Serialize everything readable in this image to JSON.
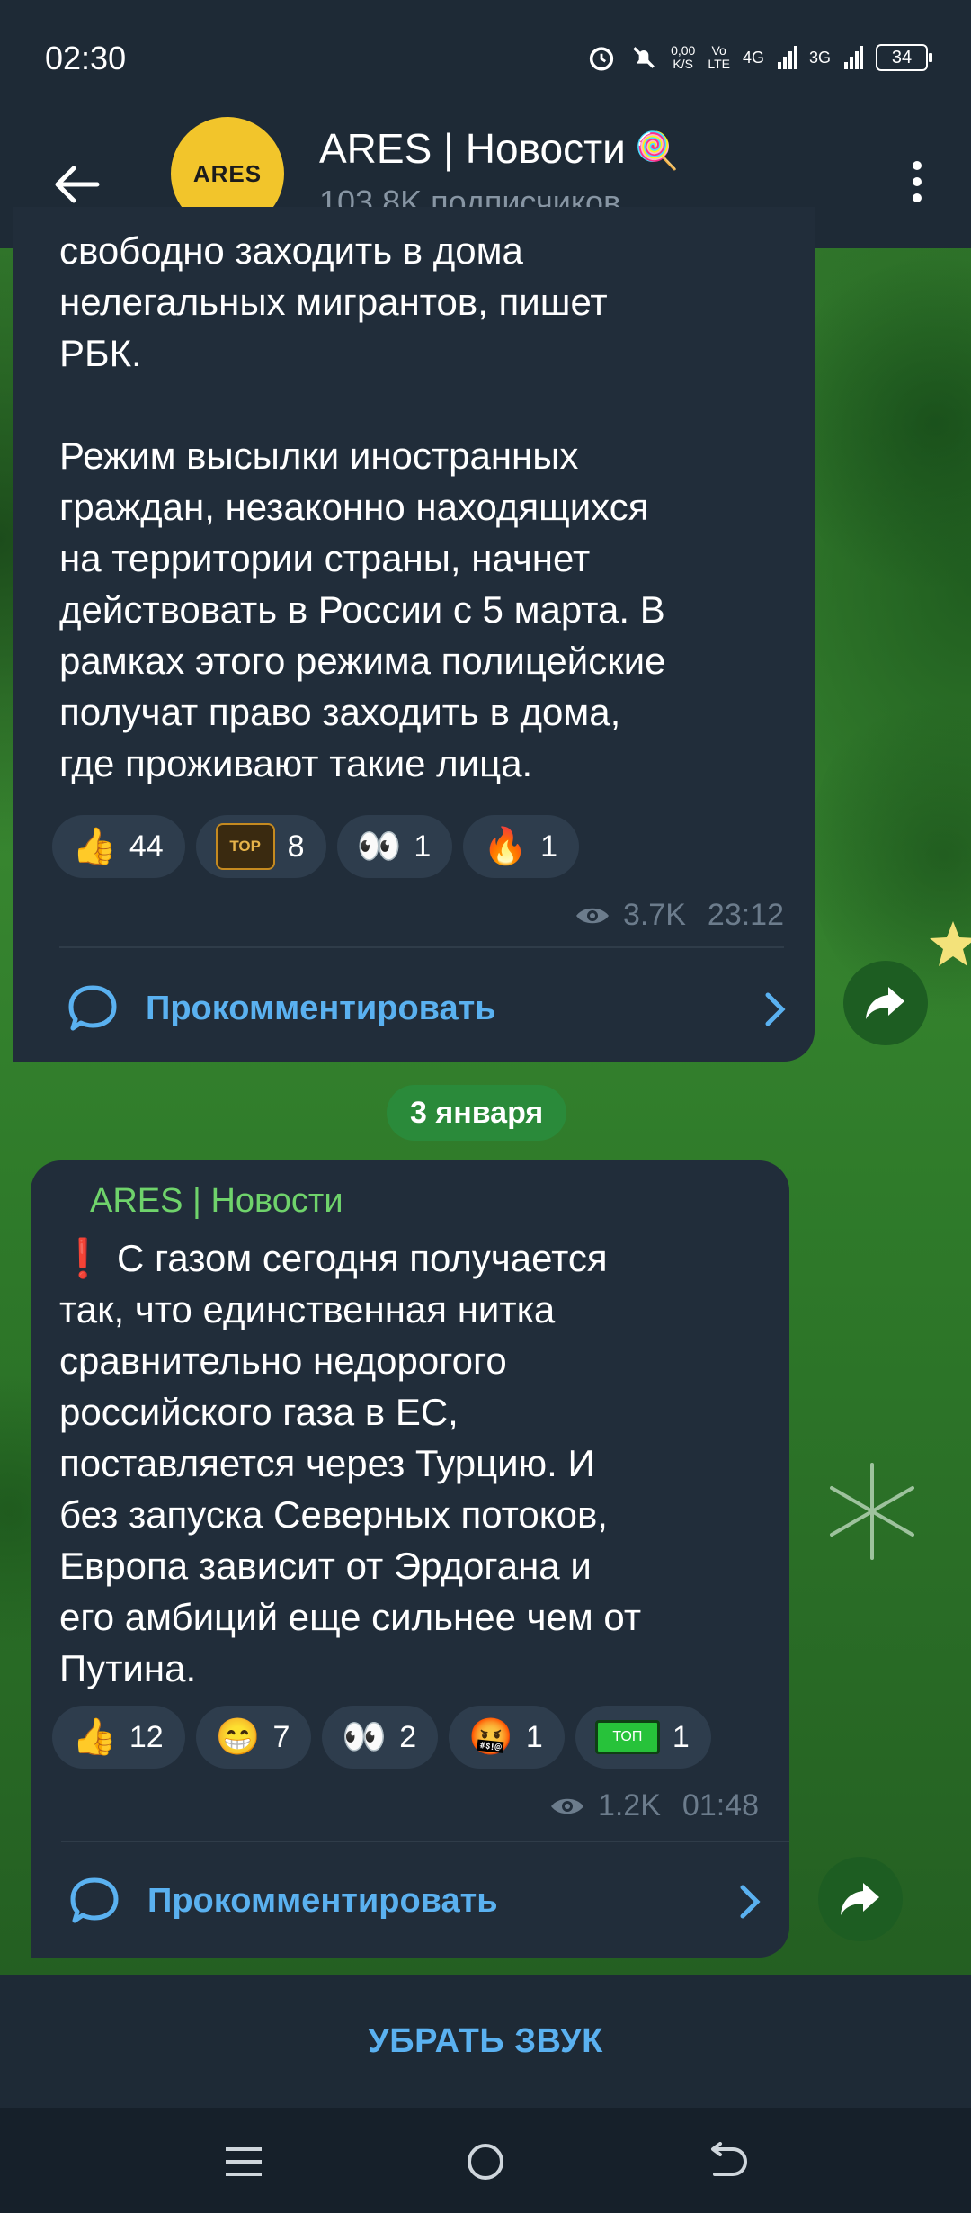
{
  "status_bar": {
    "time": "02:30",
    "net_speed_top": "0,00",
    "net_speed_bottom": "K/S",
    "volte_top": "Vo",
    "volte_bottom": "LTE",
    "network_1": "4G",
    "network_2": "3G",
    "battery": "34",
    "icons": [
      "alarm-icon",
      "mute-bell-icon",
      "signal-icon"
    ]
  },
  "header": {
    "avatar_text": "ARES",
    "channel_title": "ARES | Новости",
    "title_emoji": "🍭",
    "subscribers": "103.8K подписчиков",
    "back_icon": "back-arrow-icon",
    "menu_icon": "more-vert-icon"
  },
  "messages": [
    {
      "text": "свободно заходить в дома\nнелегальных мигрантов, пишет\nРБК.\n\nРежим высылки иностранных\nграждан, незаконно находящихся\nна территории страны, начнет\nдействовать в России с 5 марта. В\nрамках этого режима полицейские\nполучат право заходить в дома,\nгде проживают такие лица.",
      "reactions": [
        {
          "emoji": "👍",
          "count": "44"
        },
        {
          "emoji": "TOP",
          "count": "8"
        },
        {
          "emoji": "👀",
          "count": "1"
        },
        {
          "emoji": "🔥",
          "count": "1"
        }
      ],
      "views": "3.7K",
      "time": "23:12",
      "comment_label": "Прокомментировать"
    },
    {
      "sender": "ARES | Новости",
      "text": "❗ С газом сегодня получается\nтак, что единственная нитка\nсравнительно недорогого\nроссийского газа в ЕС,\nпоставляется через Турцию. И\nбез запуска Северных потоков,\nЕвропа зависит от Эрдогана и\nего амбиций еще сильнее чем от\nПутина.",
      "reactions": [
        {
          "emoji": "👍",
          "count": "12"
        },
        {
          "emoji": "😁",
          "count": "7"
        },
        {
          "emoji": "👀",
          "count": "2"
        },
        {
          "emoji": "🤬",
          "count": "1"
        },
        {
          "emoji": "ТОП",
          "count": "1"
        }
      ],
      "views": "1.2K",
      "time": "01:48",
      "comment_label": "Прокомментировать"
    }
  ],
  "date_separator": "3 января",
  "bottom": {
    "unmute_label": "УБРАТЬ ЗВУК"
  },
  "nav": {
    "icons": [
      "recents-icon",
      "home-icon",
      "back-icon"
    ]
  },
  "colors": {
    "bubble": "#212d3a",
    "accent_link": "#5ab1f0",
    "sender_green": "#6fd36b",
    "header_bg": "#1e2a36"
  }
}
